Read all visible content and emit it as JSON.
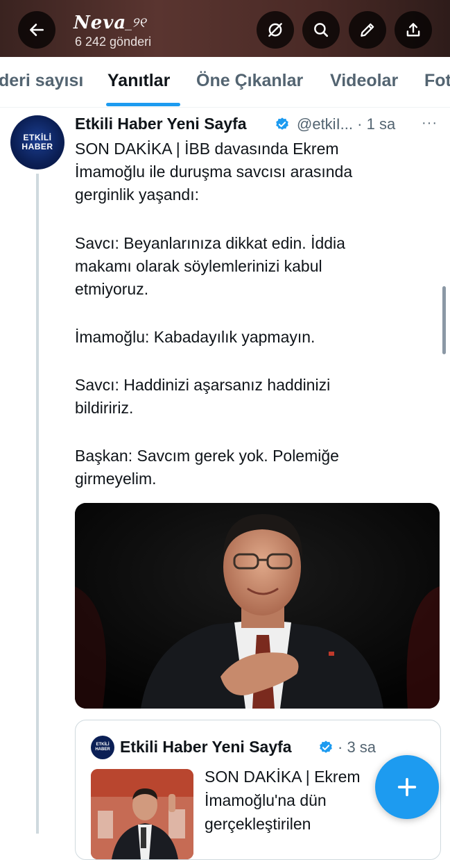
{
  "header": {
    "profile_name": "Neva",
    "profile_name_deco": "_୨୧",
    "post_count": "6 242 gönderi",
    "back_icon": "arrow-left-icon",
    "actions": [
      "mute-icon",
      "search-icon",
      "edit-icon",
      "share-icon"
    ]
  },
  "tabs": [
    "deri sayısı",
    "Yanıtlar",
    "Öne Çıkanlar",
    "Videolar",
    "Fot"
  ],
  "active_tab": "Yanıtlar",
  "post": {
    "avatar_line1": "ETKİLİ",
    "avatar_line2": "HABER",
    "author": "Etkili Haber Yeni Sayfa",
    "handle": "@etkiI...",
    "time": "· 1 sa",
    "more": "···",
    "lines": [
      "SON DAKİKA | İBB davasında Ekrem",
      "İmamoğlu ile duruşma savcısı arasında",
      "gerginlik yaşandı:",
      "Savcı: Beyanlarınıza dikkat edin. İddia",
      "makamı olarak söylemlerinizi kabul",
      "etmiyoruz.",
      "İmamoğlu: Kabadayılık yapmayın.",
      "Savcı: Haddinizi aşarsanız haddinizi",
      "bildiririz.",
      "Başkan: Savcım gerek yok. Polemiğe",
      "girmeyelim."
    ]
  },
  "quote": {
    "avatar_line1": "ETKİLİ",
    "avatar_line2": "HABER",
    "author": "Etkili Haber Yeni Sayfa",
    "time": "· 3 sa",
    "lines": [
      "SON DAKİKA | Ekrem",
      "İmamoğlu'na dün",
      "gerçekleştirilen"
    ]
  },
  "colors": {
    "accent": "#1d9bf0",
    "text": "#0f1419",
    "secondary": "#536471"
  }
}
